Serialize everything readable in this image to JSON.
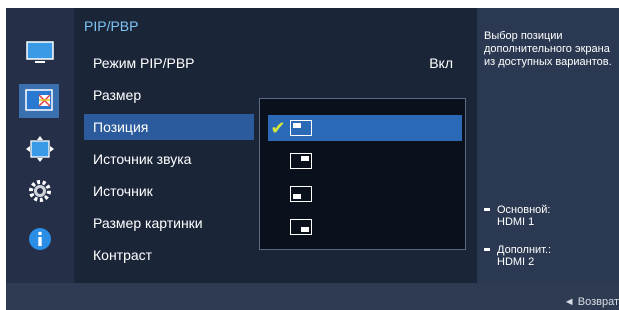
{
  "panel": {
    "title": "PIP/PBP"
  },
  "menu": [
    {
      "label": "Режим PIP/PBP",
      "value": "Вкл"
    },
    {
      "label": "Размер",
      "value": ""
    },
    {
      "label": "Позиция",
      "value": ""
    },
    {
      "label": "Источник звука",
      "value": ""
    },
    {
      "label": "Источник",
      "value": ""
    },
    {
      "label": "Размер картинки",
      "value": ""
    },
    {
      "label": "Контраст",
      "value": ""
    }
  ],
  "selected_menu": "Позиция",
  "position_options": [
    {
      "id": "top-left",
      "checked": true
    },
    {
      "id": "top-right",
      "checked": false
    },
    {
      "id": "bottom-left",
      "checked": false
    },
    {
      "id": "bottom-right",
      "checked": false
    }
  ],
  "info": {
    "description": "Выбор позиции дополнительного экрана из доступных вариантов.",
    "main_label": "Основной:",
    "main_value": "HDMI 1",
    "sub_label": "Дополнит.:",
    "sub_value": "HDMI 2"
  },
  "footer": {
    "back_label": "◄ Возврат"
  },
  "icons": [
    "picture-icon",
    "pip-icon",
    "move-icon",
    "settings-gear-icon",
    "info-icon"
  ],
  "colors": {
    "accent": "#2a6ab6",
    "check": "#d4e63a",
    "title": "#7ec3f5"
  }
}
